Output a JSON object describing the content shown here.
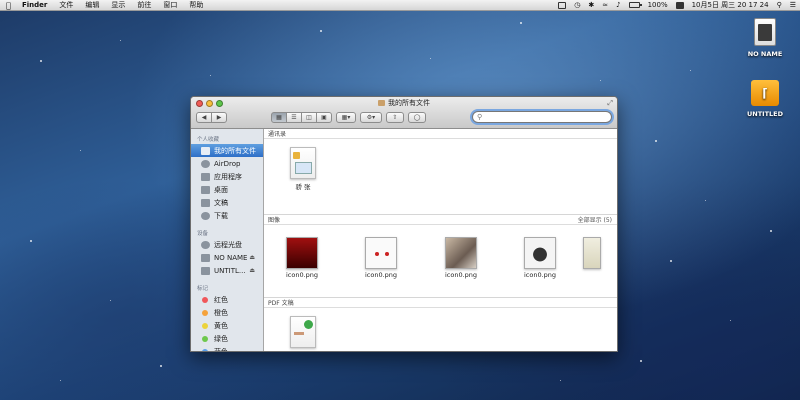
{
  "menubar": {
    "app": "Finder",
    "menus": [
      "文件",
      "编辑",
      "显示",
      "前往",
      "窗口",
      "帮助"
    ],
    "battery": "100%",
    "datetime": "10月5日 周三  20 17 24"
  },
  "desktop": {
    "icons": [
      {
        "label": "NO NAME"
      },
      {
        "label": "UNTITLED"
      }
    ]
  },
  "window": {
    "title": "我的所有文件",
    "search": {
      "value": ""
    },
    "sidebar": {
      "favorites_title": "个人收藏",
      "favorites": [
        "我的所有文件",
        "AirDrop",
        "应用程序",
        "桌面",
        "文稿",
        "下载"
      ],
      "devices_title": "设备",
      "devices": [
        "远程光盘",
        "NO NAME",
        "UNTITL..."
      ],
      "tags_title": "标记",
      "tags": [
        {
          "label": "红色",
          "color": "#f0575a"
        },
        {
          "label": "橙色",
          "color": "#f5a23b"
        },
        {
          "label": "黄色",
          "color": "#ecd33b"
        },
        {
          "label": "绿色",
          "color": "#6ec84c"
        },
        {
          "label": "蓝色",
          "color": "#5aa0ec"
        }
      ]
    },
    "groups": {
      "contacts": {
        "title": "通讯录",
        "files": [
          "骄 张"
        ]
      },
      "images": {
        "title": "图像",
        "more": "全部显示 (5)",
        "files": [
          "icon0.png",
          "icon0.png",
          "icon0.png",
          "icon0.png"
        ]
      },
      "pdf": {
        "title": "PDF 文稿"
      }
    }
  }
}
